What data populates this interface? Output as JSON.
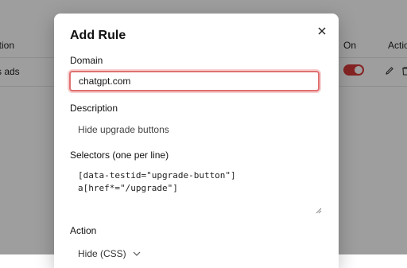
{
  "table": {
    "header_description": "ption",
    "header_on": "On",
    "header_actions": "Actio",
    "row_description": "s ads",
    "row_enabled": true
  },
  "modal": {
    "title": "Add Rule",
    "close_icon": "close-icon",
    "domain": {
      "label": "Domain",
      "value": "chatgpt.com"
    },
    "description": {
      "label": "Description",
      "value": "Hide upgrade buttons"
    },
    "selectors": {
      "label": "Selectors (one per line)",
      "lines": [
        "[data-testid=\"upgrade-button\"]",
        "a[href*=\"/upgrade\"]"
      ]
    },
    "action": {
      "label": "Action",
      "selected": "Hide (CSS)"
    }
  },
  "colors": {
    "accent": "#d93a3a",
    "focus_border": "#e07070",
    "overlay": "rgba(0,0,0,0.38)"
  }
}
